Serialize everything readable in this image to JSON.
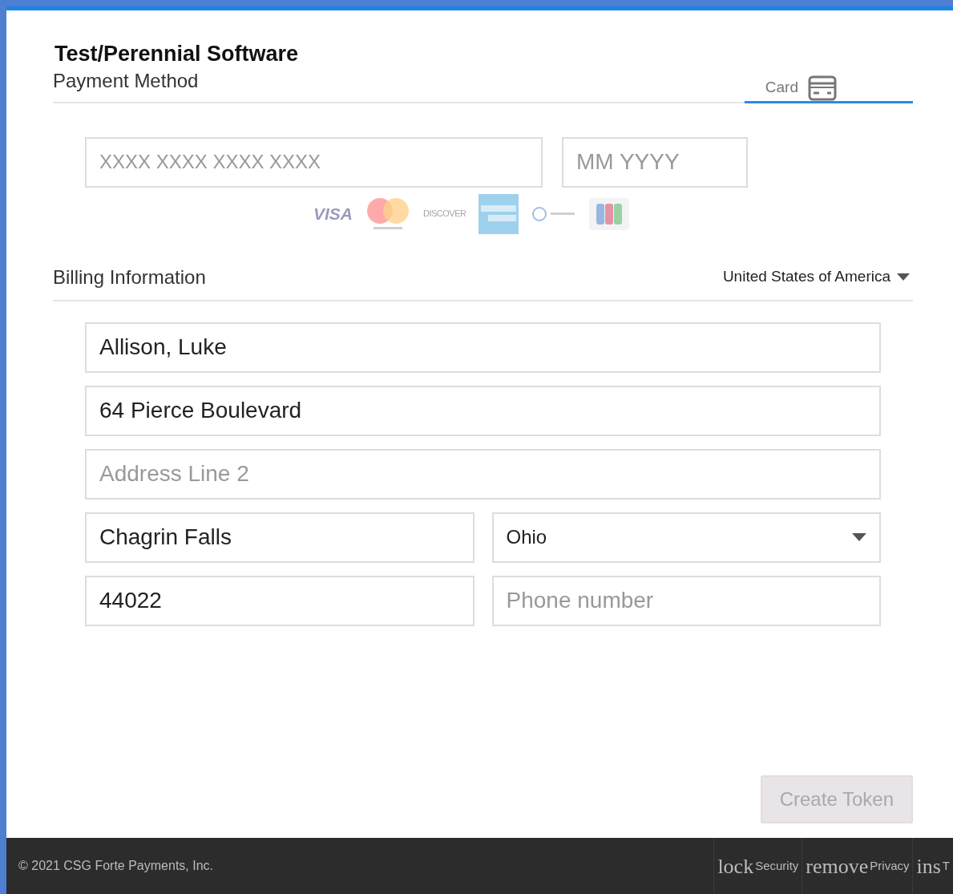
{
  "header": {
    "merchant": "Test/Perennial Software",
    "section": "Payment Method"
  },
  "tabs": [
    {
      "label": "Card",
      "selected": true
    }
  ],
  "card_fields": [
    {
      "placeholder": "XXXX XXXX XXXX XXXX",
      "kind": "number"
    },
    {
      "placeholder": "MM YYYY",
      "kind": "expiry"
    }
  ],
  "card_brands": [
    {
      "kind": "visa",
      "label": "VISA"
    },
    {
      "kind": "mastercard"
    },
    {
      "kind": "discover",
      "label": "DISCOVER"
    },
    {
      "kind": "amex"
    },
    {
      "kind": "diners"
    },
    {
      "kind": "jcb"
    }
  ],
  "billing": {
    "title": "Billing Information",
    "country": "United States of America"
  },
  "rows": [
    {
      "fields": [
        {
          "kind": "text",
          "value": "Allison, Luke"
        }
      ]
    },
    {
      "fields": [
        {
          "kind": "text",
          "value": "64 Pierce Boulevard"
        }
      ]
    },
    {
      "fields": [
        {
          "kind": "text",
          "placeholder": "Address Line 2"
        }
      ]
    },
    {
      "fields": [
        {
          "kind": "text",
          "value": "Chagrin Falls"
        },
        {
          "kind": "select",
          "value": "Ohio"
        }
      ]
    },
    {
      "fields": [
        {
          "kind": "text",
          "value": "44022"
        },
        {
          "kind": "text",
          "placeholder": "Phone number"
        }
      ]
    }
  ],
  "submit": {
    "label": "Create Token",
    "disabled": true
  },
  "footer": {
    "copyright": "© 2021 CSG Forte Payments, Inc.",
    "links": [
      {
        "icon_text": "lock",
        "label": "Security"
      },
      {
        "icon_text": "remove",
        "label": "Privacy"
      },
      {
        "icon_text": "ins",
        "label": "T"
      }
    ]
  }
}
